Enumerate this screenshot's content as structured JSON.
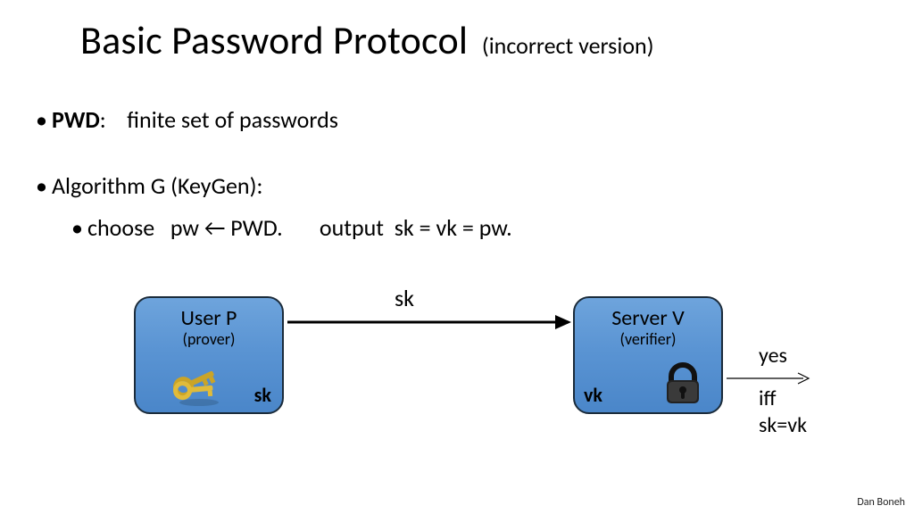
{
  "title": {
    "main": "Basic Password Protocol",
    "sub": "(incorrect version)"
  },
  "bullet1": {
    "label": "PWD",
    "rest": ":    finite set of passwords"
  },
  "bullet2": "Algorithm G   (KeyGen):",
  "bullet2sub": "choose   pw ← PWD.       output  sk = vk = pw.",
  "user": {
    "line1": "User  P",
    "line2": "(prover)",
    "corner": "sk"
  },
  "server": {
    "line1": "Server V",
    "line2": "(verifier)",
    "corner": "vk"
  },
  "arrow_label": "sk",
  "result": {
    "yes": "yes",
    "iff": "iff  sk=vk"
  },
  "credit": "Dan Boneh"
}
